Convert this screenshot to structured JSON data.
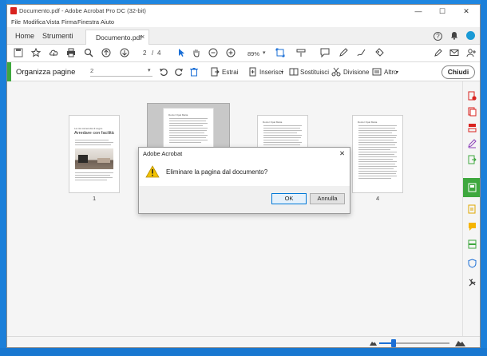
{
  "window": {
    "title": "Documento.pdf - Adobe Acrobat Pro DC (32-bit)",
    "controls": {
      "minimize": "—",
      "maximize": "☐",
      "close": "✕"
    }
  },
  "menu": [
    "File",
    "Modifica",
    "Vista",
    "Firma",
    "Finestra",
    "Aiuto"
  ],
  "tabs": {
    "home": "Home",
    "tools": "Strumenti",
    "document": "Documento.pdf",
    "close_glyph": "×"
  },
  "header_icons": {
    "help": "?",
    "bell": "🔔"
  },
  "toolbar": {
    "current_page": "2",
    "page_separator": "/",
    "total_pages": "4",
    "zoom": "89%",
    "zoom_caret": "▾"
  },
  "organize": {
    "title": "Organizza pagine",
    "page_range_value": "2",
    "page_range_caret": "▾",
    "extract": "Estrai",
    "insert": "Inserisci",
    "insert_caret": "▾",
    "replace": "Sostituisci",
    "split": "Divisione",
    "more": "Altro",
    "more_caret": "▾",
    "close": "Chiudi"
  },
  "pages": [
    {
      "number": "1",
      "heading_small": "La mia cameretta di sogno",
      "heading": "Arredare con facilità"
    },
    {
      "number": "2",
      "heading_small": "Doctor Opal Maria"
    },
    {
      "number": "3",
      "heading_small": "Doctor Opal Maria"
    },
    {
      "number": "4",
      "heading_small": "Doctor Opal Maria"
    }
  ],
  "dialog": {
    "title": "Adobe Acrobat",
    "close_glyph": "✕",
    "message": "Eliminare la pagina dal documento?",
    "ok": "OK",
    "cancel": "Annulla"
  },
  "zoom_slider": {
    "value_fraction": 0.2
  },
  "colors": {
    "accent_green": "#3ea83e",
    "acrobat_red": "#d9231f",
    "primary_blue": "#1b6fd6",
    "desktop_blue": "#1f86e0"
  }
}
